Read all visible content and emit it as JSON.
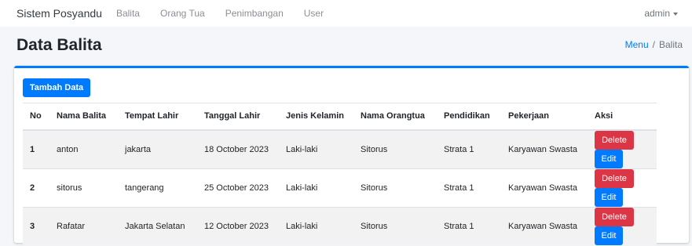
{
  "navbar": {
    "brand": "Sistem Posyandu",
    "links": [
      "Balita",
      "Orang Tua",
      "Penimbangan",
      "User"
    ],
    "user": "admin"
  },
  "page": {
    "title": "Data Balita",
    "breadcrumb": {
      "home": "Menu",
      "current": "Balita"
    }
  },
  "card": {
    "add_button": "Tambah Data",
    "headers": [
      "No",
      "Nama Balita",
      "Tempat Lahir",
      "Tanggal Lahir",
      "Jenis Kelamin",
      "Nama Orangtua",
      "Pendidikan",
      "Pekerjaan",
      "Aksi"
    ],
    "rows": [
      [
        "1",
        "anton",
        "jakarta",
        "18 October 2023",
        "Laki-laki",
        "Sitorus",
        "Strata 1",
        "Karyawan Swasta"
      ],
      [
        "2",
        "sitorus",
        "tangerang",
        "25 October 2023",
        "Laki-laki",
        "Sitorus",
        "Strata 1",
        "Karyawan Swasta"
      ],
      [
        "3",
        "Rafatar",
        "Jakarta Selatan",
        "12 October 2023",
        "Laki-laki",
        "Sitorus",
        "Strata 1",
        "Karyawan Swasta"
      ]
    ],
    "delete_label": "Delete",
    "edit_label": "Edit"
  },
  "colors": {
    "primary": "#007bff",
    "danger": "#dc3545",
    "background": "#f4f6f9"
  }
}
